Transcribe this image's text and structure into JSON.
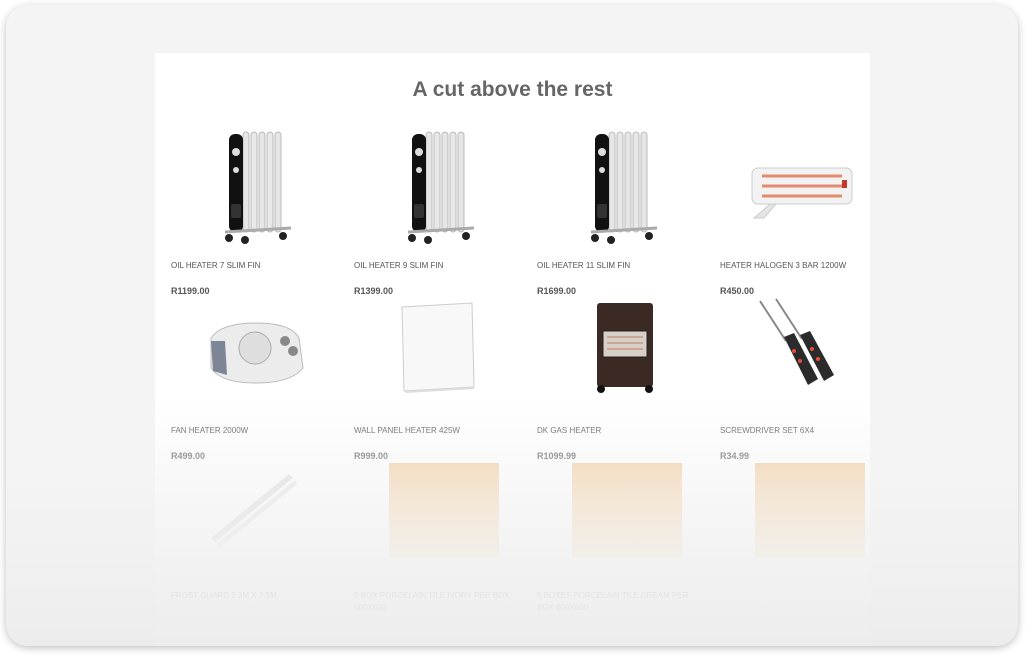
{
  "section": {
    "title": "A cut above the rest"
  },
  "products": [
    {
      "name": "OIL HEATER 7 SLIM FIN",
      "price": "R1199.00",
      "icon": "oil-heater-image"
    },
    {
      "name": "OIL HEATER 9 SLIM FIN",
      "price": "R1399.00",
      "icon": "oil-heater-image"
    },
    {
      "name": "OIL HEATER 11 SLIM FIN",
      "price": "R1699.00",
      "icon": "oil-heater-image"
    },
    {
      "name": "HEATER HALOGEN 3 BAR 1200W",
      "price": "R450.00",
      "icon": "halogen-heater-image"
    },
    {
      "name": "FAN HEATER 2000W",
      "price": "R499.00",
      "icon": "fan-heater-image"
    },
    {
      "name": "WALL PANEL HEATER 425W",
      "price": "R999.00",
      "icon": "wall-panel-heater-image"
    },
    {
      "name": "DK GAS HEATER",
      "price": "R1099.99",
      "icon": "gas-heater-image"
    },
    {
      "name": "SCREWDRIVER SET 6X4",
      "price": "R34.99",
      "icon": "screwdriver-set-image"
    },
    {
      "name": "FROST GUARD 2.3M X 7.3M",
      "price": "",
      "icon": "frost-guard-image"
    },
    {
      "name": "5 BOX PORCELAIN TILE IVORY PER BOX 600X600",
      "price": "",
      "icon": "tile-image"
    },
    {
      "name": "5 BOXES PORCELAIN TILE CREAM PER BOX 600X600",
      "price": "",
      "icon": "tile-image"
    },
    {
      "name": "",
      "price": "",
      "icon": "tile-image"
    }
  ]
}
